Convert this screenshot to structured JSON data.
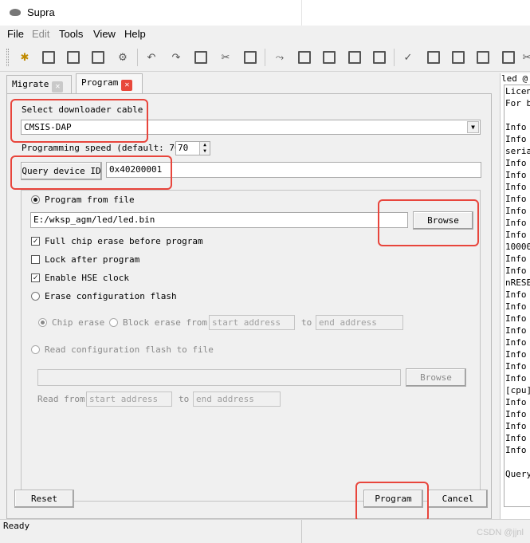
{
  "window": {
    "title": "Supra"
  },
  "menu": {
    "file": "File",
    "edit": "Edit",
    "tools": "Tools",
    "view": "View",
    "help": "Help"
  },
  "tabs": [
    {
      "label": "Migrate",
      "close": "✕",
      "close_color": "#c9c9c9"
    },
    {
      "label": "Program",
      "close": "✕",
      "close_color": "#e8483b"
    }
  ],
  "program": {
    "select_cable_label": "Select downloader cable",
    "cable_value": "CMSIS-DAP",
    "speed_label": "Programming speed (default: 70)",
    "speed_value": "70",
    "query_button": "Query device ID",
    "device_id": "0x40200001",
    "program_from_file": "Program from file",
    "file_path": "E:/wksp_agm/led/led.bin",
    "browse": "Browse",
    "full_chip_erase": "Full chip erase before program",
    "lock_after": "Lock after program",
    "enable_hse": "Enable HSE clock",
    "erase_config": "Erase configuration flash",
    "chip_erase": "Chip erase",
    "block_erase_from": "Block erase from",
    "start_placeholder": "start address",
    "to": "to",
    "end_placeholder": "end address",
    "read_config": "Read configuration flash to file",
    "browse2": "Browse",
    "read_from": "Read from",
    "reset": "Reset",
    "program_button": "Program",
    "cancel": "Cancel"
  },
  "log": {
    "header": "led @",
    "lines": [
      "Licen",
      "For b",
      "",
      "Info",
      "Info",
      "seria",
      "Info",
      "Info",
      "Info",
      "Info",
      "Info",
      "Info",
      "Info",
      "10000",
      "Info",
      "Info",
      "nRESE",
      "Info",
      "Info",
      "Info",
      "Info",
      "Info",
      "Info",
      "Info",
      "Info",
      "[cpu]",
      "Info",
      "Info",
      "Info",
      "Info",
      "Info",
      "",
      "Query"
    ]
  },
  "status": {
    "text": "Ready"
  },
  "watermark": "CSDN @jjnl",
  "colors": {
    "highlight": "#e8453c"
  }
}
